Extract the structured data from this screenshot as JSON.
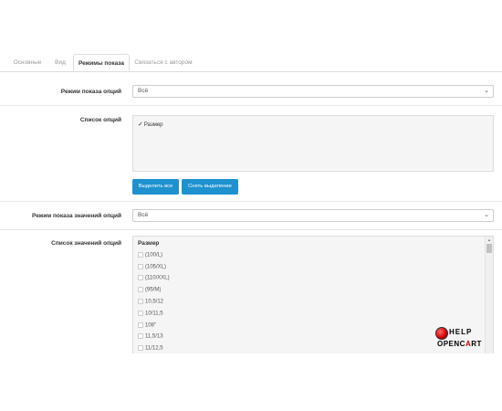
{
  "tabs": [
    {
      "label": "Основные",
      "active": false
    },
    {
      "label": "Вид",
      "active": false
    },
    {
      "label": "Режимы показа",
      "active": true
    },
    {
      "label": "Связаться с автором",
      "active": false
    }
  ],
  "form": {
    "option_mode": {
      "label": "Режим показа опций",
      "value": "Всё"
    },
    "option_list": {
      "label": "Список опций",
      "items": [
        {
          "label": "Размер",
          "checked": true
        }
      ]
    },
    "buttons": {
      "select_all": "Выделить все",
      "deselect": "Снять выделение"
    },
    "value_mode": {
      "label": "Режим показа значений опций",
      "value": "Всё"
    },
    "value_list": {
      "label": "Список значений опций",
      "group": "Размер",
      "items": [
        "(100/L)",
        "(105/XL)",
        "(110/XXL)",
        "(95/M)",
        "10,5/12",
        "10/11,5",
        "108\"",
        "11,5/13",
        "11/12,5"
      ]
    }
  },
  "logo": {
    "help": "HELP",
    "oc_pre": "OPENC",
    "oc_mid": "A",
    "oc_post": "RT"
  },
  "colors": {
    "primary_button": "#1e91cf",
    "logo_red": "#d10000"
  }
}
